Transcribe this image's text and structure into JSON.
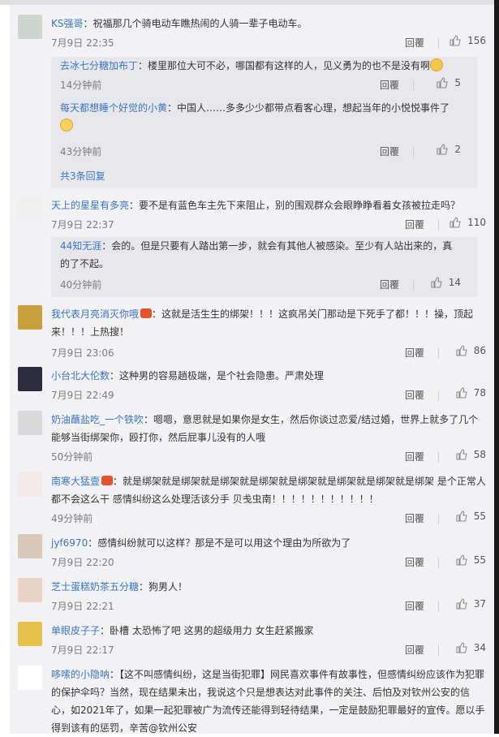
{
  "comments": [
    {
      "user": "KS强哥",
      "text": "祝福那几个骑电动车瞧热闹的人骑一辈子电动车。",
      "time": "7月9日 22:35",
      "reply": "回覆",
      "likes": "156",
      "subs": [
        {
          "user": "去冰七分糖加布丁",
          "text": "楼里那位大可不必，哪国都有这样的人，见义勇为的也不是没有啊",
          "time": "14分钟前",
          "reply": "回覆",
          "likes": "5"
        },
        {
          "user": "每天都想睡个好觉的小黄",
          "text": "中国人……多多少少都带点看客心理，想起当年的小悦悦事件了",
          "time": "43分钟前",
          "reply": "回覆",
          "likes": "2"
        }
      ],
      "more": "共3条回复"
    },
    {
      "user": "天上的星星有多亮",
      "text": "要不是有蓝色车主先下来阻止，别的围观群众会眼睁睁看着女孩被拉走吗？",
      "time": "7月9日 22:37",
      "reply": "回覆",
      "likes": "110",
      "subs": [
        {
          "user": "44知无涯",
          "text": "会的。但是只要有人踏出第一步，就会有其他人被感染。至少有人站出来的，真的了不起。",
          "time": "40分钟前",
          "reply": "回覆",
          "likes": "14"
        }
      ]
    },
    {
      "user": "我代表月亮消灭你哦",
      "text": "这就是活生生的绑架！！！这疯吊关门那动是下死手了都！！！操，顶起来！！！上热搜！",
      "time": "7月9日 23:06",
      "reply": "回覆",
      "likes": "86"
    },
    {
      "user": "小台北大伦数",
      "text": "这种男的容易趟极端，是个社会隐患。严肃处理",
      "time": "7月9日 22:49",
      "reply": "回覆",
      "likes": "78"
    },
    {
      "user": "奶油蘸盐吃_一个铁吹",
      "text": "嗯嗯，意思就是如果你是女生，然后你谈过恋爱/结过婚，世界上就多了几个能够当街绑架你，殴打你，然后屁事儿没有的人哦",
      "time": "50分钟前",
      "reply": "回覆",
      "likes": "58"
    },
    {
      "user": "南寒大猛壹",
      "text": "就是绑架就是绑架就是绑架就是绑架就是绑架就是绑架就是绑架就是绑架 是个正常人都不会这么干 感情纠纷这么处理活该分手 贝戋虫南！！！！！！！！！！！",
      "time": "49分钟前",
      "reply": "回覆",
      "likes": "55"
    },
    {
      "user": "jyf6970",
      "text": "感情纠纷就可以这样？那是不是可以用这个理由为所欲为了",
      "time": "7月9日 22:20",
      "reply": "回覆",
      "likes": "55"
    },
    {
      "user": "芝士蛋糕奶茶五分糖",
      "text": "狗男人！",
      "time": "7月9日 22:21",
      "reply": "回覆",
      "likes": "37"
    },
    {
      "user": "单眼皮子子",
      "text": "卧槽 太恐怖了吧 这男的超级用力 女生赶紧搬家",
      "time": "7月9日 22:17",
      "reply": "回覆",
      "likes": "34"
    },
    {
      "user": "哆嗦的小隐呐",
      "text": "【这不叫感情纠纷，这是当街犯罪】网民喜欢事件有故事性，但感情纠纷应该作为犯罪的保护伞吗？当然，现在结果未出，我说这个只是想表达对此事件的关注、后怕及对钦州公安的信心，如2021年了，如果一起犯罪被广为流传还能得到轻待结果，一定是鼓励犯罪最好的宣传。愿以手得到该有的惩罚，辛苦@钦州公安"
    }
  ]
}
